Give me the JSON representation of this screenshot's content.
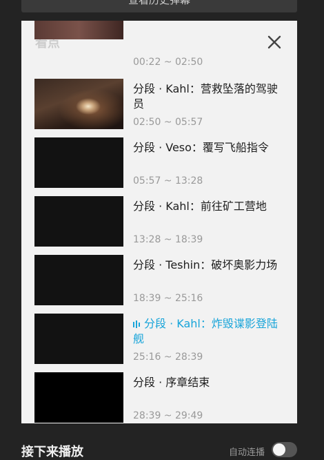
{
  "top_button": {
    "label": "查看历史弹幕"
  },
  "panel": {
    "title": "看点",
    "items": [
      {
        "title": "",
        "time": "00:22 ~ 02:50",
        "active": false
      },
      {
        "title": "分段 · Kahl：营救坠落的驾驶员",
        "time": "02:50 ~ 05:57",
        "active": false
      },
      {
        "title": "分段 · Veso：覆写飞船指令",
        "time": "05:57 ~ 13:28",
        "active": false
      },
      {
        "title": "分段 · Kahl：前往矿工营地",
        "time": "13:28 ~ 18:39",
        "active": false
      },
      {
        "title": "分段 · Teshin：破坏奥影力场",
        "time": "18:39 ~ 25:16",
        "active": false
      },
      {
        "title": "分段 · Kahl：炸毁谍影登陆舰",
        "time": "25:16 ~ 28:39",
        "active": true
      },
      {
        "title": "分段 · 序章结束",
        "time": "28:39 ~ 29:49",
        "active": false
      }
    ]
  },
  "bottom": {
    "title": "接下来播放",
    "autoplay_label": "自动连播",
    "autoplay_on": false
  },
  "colors": {
    "accent": "#17a4d9",
    "background": "#232323",
    "panel": "#f2f2f2"
  },
  "icons": {
    "close": "close-icon",
    "playing": "playing-indicator-icon"
  }
}
